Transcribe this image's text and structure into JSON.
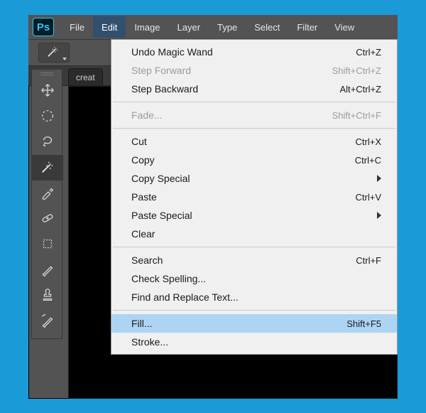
{
  "app": {
    "logo_text": "Ps"
  },
  "menubar": {
    "items": [
      {
        "label": "File"
      },
      {
        "label": "Edit",
        "open": true
      },
      {
        "label": "Image"
      },
      {
        "label": "Layer"
      },
      {
        "label": "Type"
      },
      {
        "label": "Select"
      },
      {
        "label": "Filter"
      },
      {
        "label": "View"
      }
    ]
  },
  "doctab": {
    "label": "creat"
  },
  "edit_menu": {
    "items": [
      {
        "label": "Undo Magic Wand",
        "shortcut": "Ctrl+Z",
        "disabled": false
      },
      {
        "label": "Step Forward",
        "shortcut": "Shift+Ctrl+Z",
        "disabled": true
      },
      {
        "label": "Step Backward",
        "shortcut": "Alt+Ctrl+Z",
        "disabled": false
      },
      {
        "sep": true
      },
      {
        "label": "Fade...",
        "shortcut": "Shift+Ctrl+F",
        "disabled": true
      },
      {
        "sep": true
      },
      {
        "label": "Cut",
        "shortcut": "Ctrl+X"
      },
      {
        "label": "Copy",
        "shortcut": "Ctrl+C"
      },
      {
        "label": "Copy Special",
        "submenu": true
      },
      {
        "label": "Paste",
        "shortcut": "Ctrl+V"
      },
      {
        "label": "Paste Special",
        "submenu": true
      },
      {
        "label": "Clear"
      },
      {
        "sep": true
      },
      {
        "label": "Search",
        "shortcut": "Ctrl+F"
      },
      {
        "label": "Check Spelling..."
      },
      {
        "label": "Find and Replace Text..."
      },
      {
        "sep": true
      },
      {
        "label": "Fill...",
        "shortcut": "Shift+F5",
        "highlight": true
      },
      {
        "label": "Stroke..."
      }
    ]
  },
  "tools": {
    "items": [
      {
        "name": "move-tool"
      },
      {
        "name": "marquee-tool"
      },
      {
        "name": "lasso-tool"
      },
      {
        "name": "magic-wand-tool",
        "active": true
      },
      {
        "name": "eyedropper-tool"
      },
      {
        "name": "healing-brush-tool"
      },
      {
        "name": "crop-tool"
      },
      {
        "name": "brush-tool"
      },
      {
        "name": "stamp-tool"
      },
      {
        "name": "history-brush-tool"
      }
    ]
  }
}
